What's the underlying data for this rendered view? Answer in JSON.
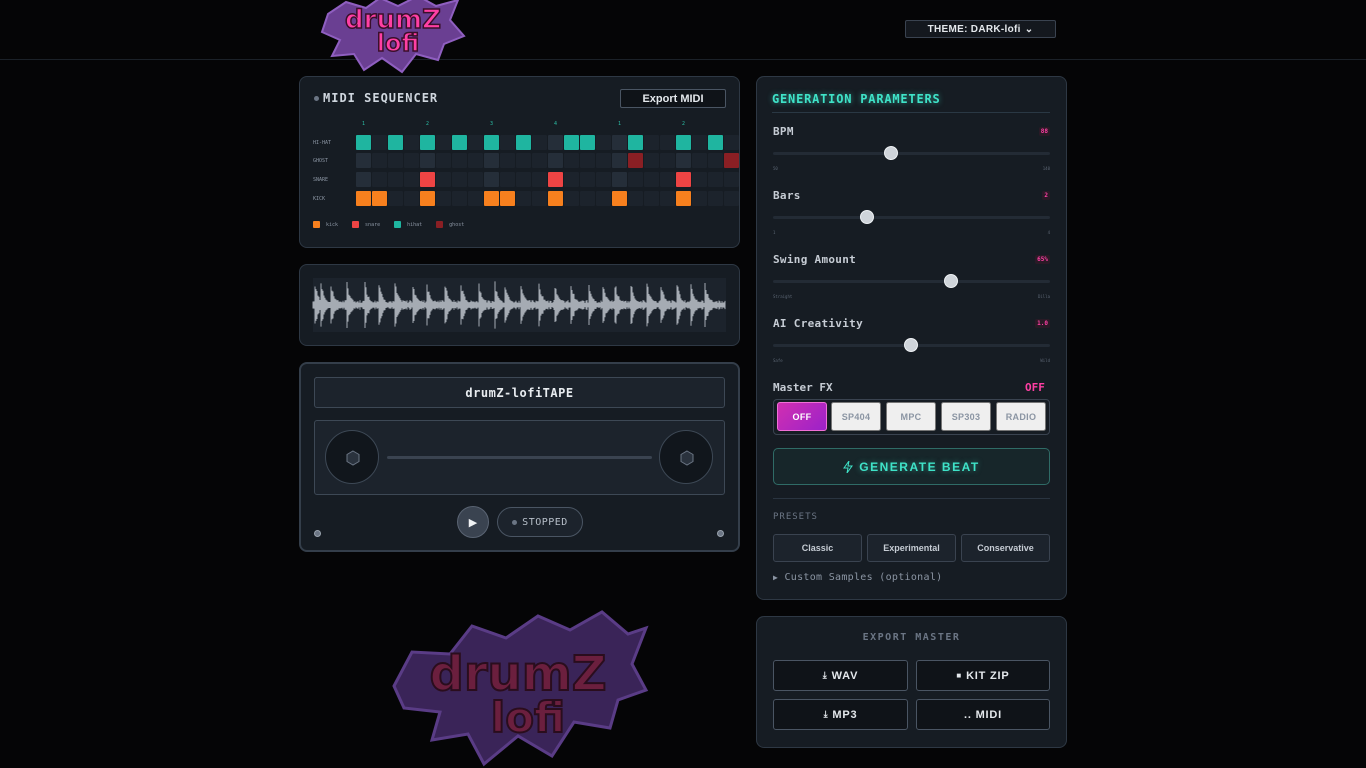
{
  "brand": {
    "logo_line1": "drumZ",
    "logo_line2": "lofi"
  },
  "header": {
    "theme_label": "THEME: DARK-lofi",
    "theme_chevron": "chevron-down-icon"
  },
  "sequencer": {
    "title": "MIDI SEQUENCER",
    "export_label": "Export MIDI",
    "beat_numbers": [
      "1",
      "2",
      "3",
      "4",
      "1",
      "2"
    ],
    "rows": [
      {
        "label": "HI-HAT",
        "color": "#1fb5a0"
      },
      {
        "label": "GHOST",
        "color": "#8a1f24"
      },
      {
        "label": "SNARE",
        "color": "#ee4444"
      },
      {
        "label": "KICK",
        "color": "#f7801e"
      }
    ],
    "legend": [
      {
        "label": "kick",
        "color": "#f7801e"
      },
      {
        "label": "snare",
        "color": "#ee4444"
      },
      {
        "label": "hihat",
        "color": "#1fb5a0"
      },
      {
        "label": "ghost",
        "color": "#8a1f24"
      }
    ]
  },
  "tape": {
    "label": "drumZ-lofiTAPE",
    "play_icon": "play-icon",
    "status": "STOPPED"
  },
  "params": {
    "title": "GENERATION PARAMETERS",
    "bpm": {
      "label": "BPM",
      "value": "88",
      "min": "50",
      "max": "140"
    },
    "bars": {
      "label": "Bars",
      "value": "2",
      "min": "1",
      "max": "4"
    },
    "swing": {
      "label": "Swing Amount",
      "value": "65%",
      "min": "Straight",
      "max": "Dilla"
    },
    "creativity": {
      "label": "AI Creativity",
      "value": "1.0",
      "min": "Safe",
      "max": "Wild"
    },
    "fx": {
      "label": "Master FX",
      "value": "OFF",
      "options": [
        "OFF",
        "SP404",
        "MPC",
        "SP303",
        "RADIO"
      ]
    },
    "generate_label": "GENERATE BEAT",
    "presets_label": "PRESETS",
    "presets": [
      "Classic",
      "Experimental",
      "Conservative"
    ],
    "custom_samples": "Custom Samples (optional)",
    "accent": "#3fe3c8",
    "highlight": "#ff3fa4"
  },
  "export": {
    "title": "EXPORT MASTER",
    "wav": "WAV",
    "kit_zip": "KIT ZIP",
    "mp3": "MP3",
    "midi": ".. MIDI"
  }
}
